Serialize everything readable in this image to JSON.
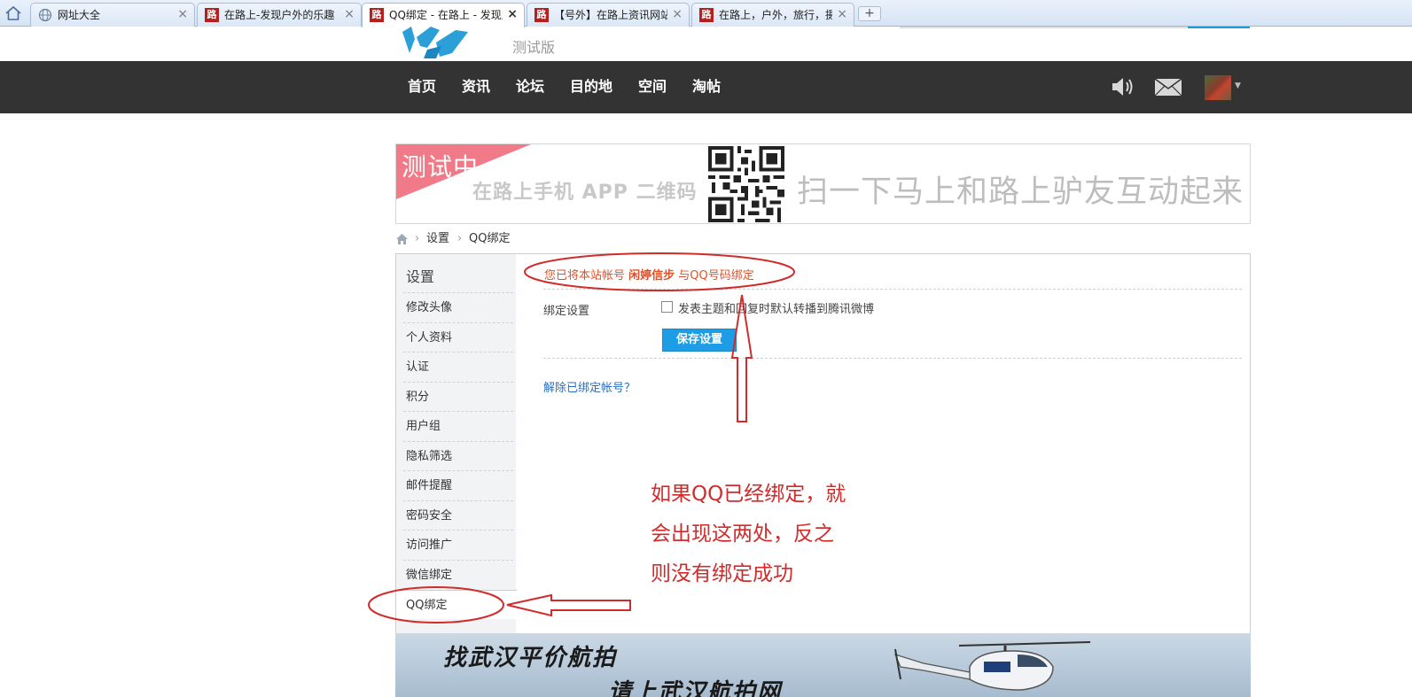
{
  "browser": {
    "tabs": [
      {
        "title": "网址大全",
        "icon": "globe-icon"
      },
      {
        "title": "在路上-发现户外的乐趣",
        "icon": "road-favicon"
      },
      {
        "title": "QQ绑定 - 在路上 - 发现户外的乐趣",
        "icon": "road-favicon",
        "active": true
      },
      {
        "title": "【号外】在路上资讯网站",
        "icon": "road-favicon"
      },
      {
        "title": "在路上，户外，旅行，摄影",
        "icon": "road-favicon"
      }
    ],
    "favicon_char": "路",
    "close_glyph": "×",
    "new_tab_glyph": "+"
  },
  "header": {
    "beta_label": "测试版",
    "nav": [
      "首页",
      "资讯",
      "论坛",
      "目的地",
      "空间",
      "淘帖"
    ]
  },
  "banner": {
    "testing": "测试中",
    "app_text": "在路上手机 APP 二维码",
    "slogan": "扫一下马上和路上驴友互动起来"
  },
  "breadcrumb": {
    "sep": "›",
    "items": [
      "设置",
      "QQ绑定"
    ]
  },
  "sidebar": {
    "title": "设置",
    "items": [
      "修改头像",
      "个人资料",
      "认证",
      "积分",
      "用户组",
      "隐私筛选",
      "邮件提醒",
      "密码安全",
      "访问推广",
      "微信绑定",
      "QQ绑定"
    ],
    "current": "QQ绑定"
  },
  "content": {
    "notice_prefix": "您已将本站帐号 ",
    "notice_username": "闲婷信步",
    "notice_suffix": " 与QQ号码绑定",
    "bind_settings_label": "绑定设置",
    "checkbox_label": "发表主题和回复时默认转播到腾讯微博",
    "checkbox_checked": false,
    "save_button": "保存设置",
    "unbind_link": "解除已绑定帐号？"
  },
  "annotation": {
    "lines": [
      "如果QQ已经绑定，就",
      "会出现这两处，反之",
      "则没有绑定成功"
    ],
    "color": "#d12b2b"
  },
  "ad": {
    "line1": "找武汉平价航拍",
    "line2": "请上武汉航拍网"
  },
  "colors": {
    "nav_bg": "#333333",
    "accent_blue": "#1d9de5",
    "notice_red": "#d9532c",
    "link_blue": "#2a6fb8"
  }
}
